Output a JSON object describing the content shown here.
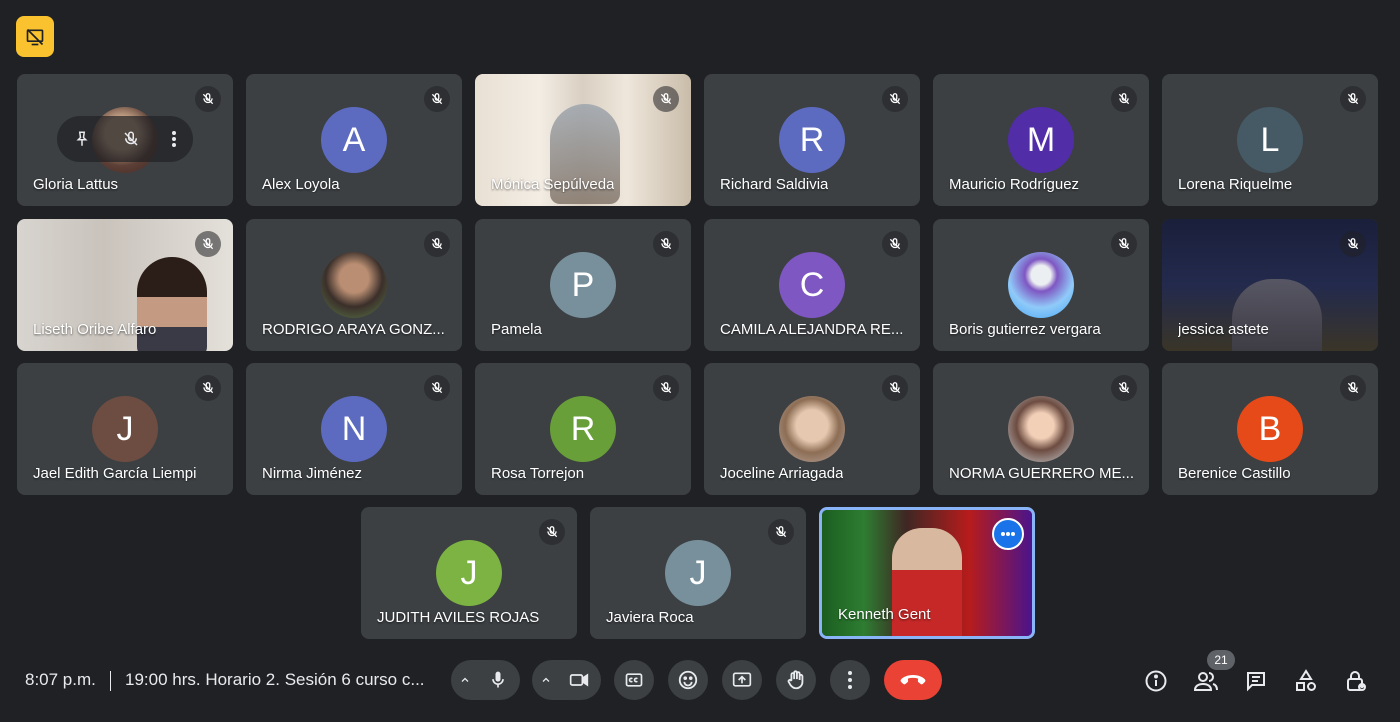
{
  "participants": [
    {
      "name": "Gloria Lattus",
      "avatar": "",
      "avatar_color": "#8d6e63",
      "kind": "photo"
    },
    {
      "name": "Alex Loyola",
      "avatar": "A",
      "avatar_color": "#5c6bc0",
      "kind": "letter"
    },
    {
      "name": "Mónica Sepúlveda",
      "avatar": "",
      "avatar_color": "#d7ccc8",
      "kind": "video"
    },
    {
      "name": "Richard Saldivia",
      "avatar": "R",
      "avatar_color": "#5c6bc0",
      "kind": "letter"
    },
    {
      "name": "Mauricio Rodríguez",
      "avatar": "M",
      "avatar_color": "#512da8",
      "kind": "letter"
    },
    {
      "name": "Lorena Riquelme",
      "avatar": "L",
      "avatar_color": "#455a64",
      "kind": "letter"
    },
    {
      "name": "Liseth Oribe Alfaro",
      "avatar": "",
      "avatar_color": "#bdbdbd",
      "kind": "video"
    },
    {
      "name": "RODRIGO ARAYA GONZ...",
      "avatar": "",
      "avatar_color": "#6d5c4a",
      "kind": "photo"
    },
    {
      "name": "Pamela",
      "avatar": "P",
      "avatar_color": "#78909c",
      "kind": "letter"
    },
    {
      "name": "CAMILA ALEJANDRA RE...",
      "avatar": "C",
      "avatar_color": "#7e57c2",
      "kind": "letter"
    },
    {
      "name": "Boris gutierrez vergara",
      "avatar": "",
      "avatar_color": "#64b5f6",
      "kind": "photo"
    },
    {
      "name": "jessica astete",
      "avatar": "",
      "avatar_color": "#1a237e",
      "kind": "video"
    },
    {
      "name": "Jael Edith García Liempi",
      "avatar": "J",
      "avatar_color": "#6d4c41",
      "kind": "letter"
    },
    {
      "name": "Nirma Jiménez",
      "avatar": "N",
      "avatar_color": "#5c6bc0",
      "kind": "letter"
    },
    {
      "name": "Rosa Torrejon",
      "avatar": "R",
      "avatar_color": "#689f38",
      "kind": "letter"
    },
    {
      "name": "Joceline Arriagada",
      "avatar": "",
      "avatar_color": "#c8a890",
      "kind": "photo"
    },
    {
      "name": "NORMA GUERRERO ME...",
      "avatar": "",
      "avatar_color": "#795548",
      "kind": "photo"
    },
    {
      "name": "Berenice Castillo",
      "avatar": "B",
      "avatar_color": "#e64a19",
      "kind": "letter"
    },
    {
      "name": "JUDITH AVILES ROJAS",
      "avatar": "J",
      "avatar_color": "#7cb342",
      "kind": "letter"
    },
    {
      "name": "Javiera Roca",
      "avatar": "J",
      "avatar_color": "#78909c",
      "kind": "letter"
    },
    {
      "name": "Kenneth Gent",
      "avatar": "",
      "avatar_color": "#b71c1c",
      "kind": "video"
    }
  ],
  "bottom_bar": {
    "time": "8:07 p.m.",
    "meeting_title": "19:00 hrs. Horario 2. Sesión 6 curso c...",
    "participant_count": "21"
  },
  "colors": {
    "background": "#202124",
    "tile": "#3c4043",
    "end_call": "#ea4335",
    "accent": "#8ab4f8",
    "badge": "#f9c22e"
  }
}
